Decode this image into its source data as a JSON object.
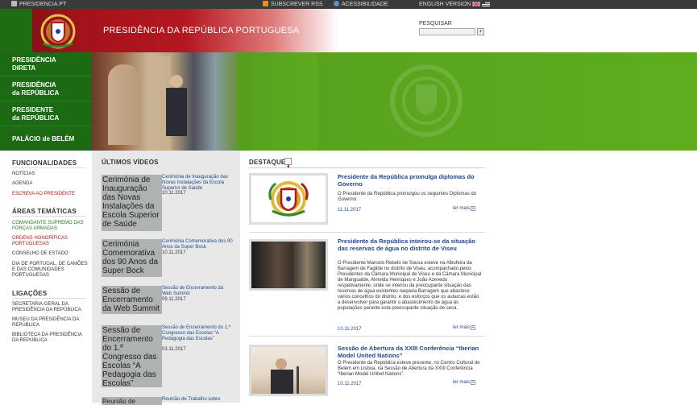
{
  "topbar": {
    "site": "PRESIDENCIA.PT",
    "rss": "SUBSCREVER RSS",
    "accessibility": "ACESSIBILIDADE",
    "english": "ENGLISH VERSION"
  },
  "header": {
    "title": "PRESIDÊNCIA DA REPÚBLICA PORTUGUESA",
    "search_label": "PESQUISAR",
    "search_button": "+"
  },
  "nav": [
    {
      "line1": "PRESIDÊNCIA",
      "line2": "DIRETA"
    },
    {
      "line1": "PRESIDÊNCIA",
      "line2": "da REPÚBLICA"
    },
    {
      "line1": "PRESIDENTE",
      "line2": "da REPÚBLICA"
    },
    {
      "line1": "PALÁCIO de BELÉM",
      "line2": ""
    }
  ],
  "sidebar": {
    "funcionalidades_title": "FUNCIONALIDADES",
    "funcionalidades": [
      "NOTÍCIAS",
      "AGENDA",
      "ESCREVA AO PRESIDENTE"
    ],
    "areas_title": "ÁREAS TEMÁTICAS",
    "areas": [
      "COMANDANTE SUPREMO DAS FORÇAS ARMADAS",
      "ORDENS HONORÍFICAS PORTUGUESAS",
      "CONSELHO DE ESTADO",
      "DIA DE PORTUGAL, DE CAMÕES E DAS COMUNIDADES PORTUGUESAS"
    ],
    "ligacoes_title": "LIGAÇÕES",
    "ligacoes": [
      "SECRETARIA-GERAL DA PRESIDÊNCIA DA REPÚBLICA",
      "MUSEU DA PRESIDÊNCIA DA REPÚBLICA",
      "BIBLIOTECA DA PRESIDÊNCIA DA REPÚBLICA"
    ],
    "colors": {
      "green_link": "#2d7a1a",
      "red_link": "#a51f1f"
    }
  },
  "videos": {
    "title": "ÚLTIMOS VÍDEOS",
    "items": [
      {
        "thumb_alt": "Cerimónia de Inauguração das Novas Instalações da Escola Superior de Saúde",
        "title": "Cerimónia de Inauguração das Novas Instalações da Escola Superior de Saúde",
        "date": "10.11.2017"
      },
      {
        "thumb_alt": "Cerimónia Comemorativa dos 90 Anos da Super Bock",
        "title": "Cerimónia Comemorativa dos 90 Anos da Super Bock",
        "date": "10.11.2017"
      },
      {
        "thumb_alt": "Sessão de Encerramento da Web Summit",
        "title": "Sessão de Encerramento da Web Summit",
        "date": "09.11.2017"
      },
      {
        "thumb_alt": "Sessão de Encerramento do 1.º Congresso das Escolas “A Pedagogia das Escolas”",
        "title": "Sessão de Encerramento do 1.º Congresso das Escolas “A Pedagogia das Escolas”",
        "date": "03.11.2017"
      },
      {
        "thumb_alt": "Reunião de Trabalho sobre",
        "title": "Reunião de Trabalho sobre",
        "date": ""
      }
    ]
  },
  "destaque": {
    "title": "DESTAQUE",
    "more_label": "ler mais",
    "items": [
      {
        "title": "Presidente da República promulga diplomas do Governo",
        "text": "O Presidente da República promulgou os seguintes Diplomas do Governo:",
        "date": "11.11.2017"
      },
      {
        "title": "Presidente da República inteirou-se da situação das reservas de água no distrito de Viseu",
        "text": "O Presidente Marcelo Rebelo de Sousa esteve na Albufeira da Barragem de Fagilde no distrito de Viseu, acompanhado pelos Presidentes da Câmara Municipal de Viseu e da Câmara Municipal de Mangualde, Almeida Henriques e João Azevedo respetivamente, onde se inteirou da preocupante situação das reservas de água existentes naquela Barragem que abastece vários concelhos do distrito, e dos esforços que os autarcas estão a desenvolver para garantir o abastecimento de água às populações perante esta preocupante situação de seca.",
        "date": "10.11.2017"
      },
      {
        "title": "Sessão de Abertura da XXIII Conferência “Iberian Model United Nations”",
        "text": "O Presidente da República esteve presente, no Centro Cultural de Belém em Lisboa, na Sessão de Abertura da XXIII Conferência “Iberian Model United Nations”.",
        "date": "10.11.2017"
      }
    ]
  }
}
